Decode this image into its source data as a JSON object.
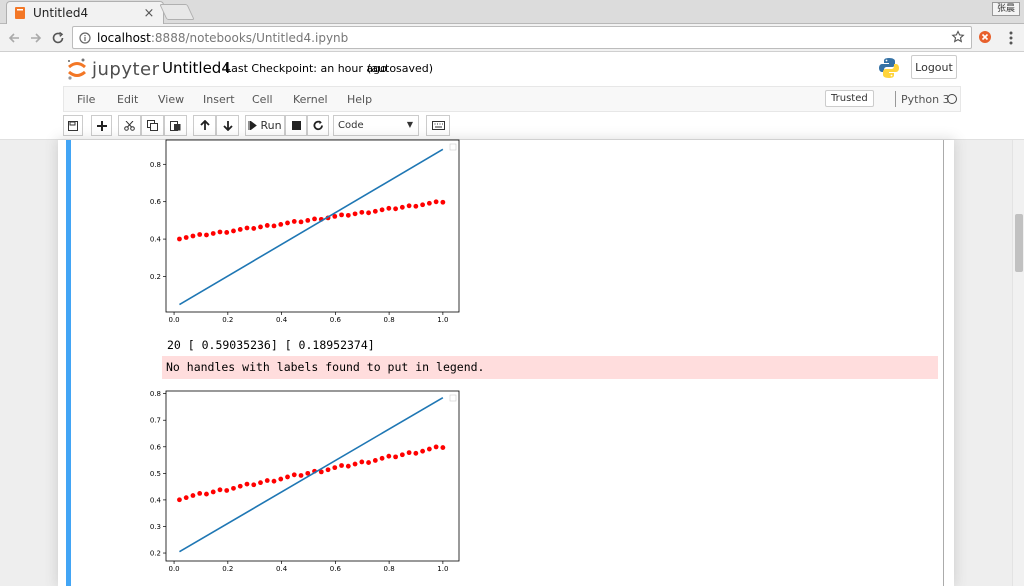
{
  "browser": {
    "tab_title": "Untitled4",
    "tab_close": "×",
    "profile": "张晨",
    "url_host": "localhost",
    "url_rest": ":8888/notebooks/Untitled4.ipynb"
  },
  "header": {
    "logo_text": "jupyter",
    "notebook_name": "Untitled4",
    "checkpoint": "Last Checkpoint: an hour ago",
    "autosave": "(autosaved)",
    "logout": "Logout"
  },
  "menubar": {
    "items": [
      "File",
      "Edit",
      "View",
      "Insert",
      "Cell",
      "Kernel",
      "Help"
    ],
    "trusted": "Trusted",
    "kernel": "Python 3"
  },
  "toolbar": {
    "run_label": "Run",
    "cell_type": "Code",
    "icons": [
      "save-icon",
      "add-cell-icon",
      "cut-icon",
      "copy-icon",
      "paste-icon",
      "move-up-icon",
      "move-down-icon",
      "run-icon",
      "stop-icon",
      "restart-icon",
      "keyboard-icon"
    ]
  },
  "output": {
    "stdout": "20 [ 0.59035236] [ 0.18952374]",
    "stderr": "No handles with labels found to put in legend."
  },
  "chart_data": [
    {
      "type": "line",
      "x_ticks": [
        "0.0",
        "0.2",
        "0.4",
        "0.6",
        "0.8",
        "1.0"
      ],
      "y_ticks": [
        "0.2",
        "0.4",
        "0.6",
        "0.8"
      ],
      "xlim": [
        -0.03,
        1.06
      ],
      "ylim": [
        0.01,
        0.93
      ],
      "grid": false,
      "series": [
        {
          "kind": "line",
          "color": "#1f77b4",
          "x": [
            0.02,
            1.0
          ],
          "y": [
            0.05,
            0.88
          ]
        },
        {
          "kind": "scatter",
          "color": "#ff0000",
          "x_range": [
            0.02,
            1.0
          ],
          "y_range": [
            0.405,
            0.6
          ],
          "points": 40
        }
      ]
    },
    {
      "type": "line",
      "x_ticks": [
        "0.0",
        "0.2",
        "0.4",
        "0.6",
        "0.8",
        "1.0"
      ],
      "y_ticks": [
        "0.2",
        "0.3",
        "0.4",
        "0.5",
        "0.6",
        "0.7",
        "0.8"
      ],
      "xlim": [
        -0.03,
        1.06
      ],
      "ylim": [
        0.17,
        0.81
      ],
      "grid": false,
      "series": [
        {
          "kind": "line",
          "color": "#1f77b4",
          "x": [
            0.02,
            1.0
          ],
          "y": [
            0.205,
            0.785
          ]
        },
        {
          "kind": "scatter",
          "color": "#ff0000",
          "x_range": [
            0.02,
            1.0
          ],
          "y_range": [
            0.405,
            0.6
          ],
          "points": 40
        }
      ]
    }
  ]
}
